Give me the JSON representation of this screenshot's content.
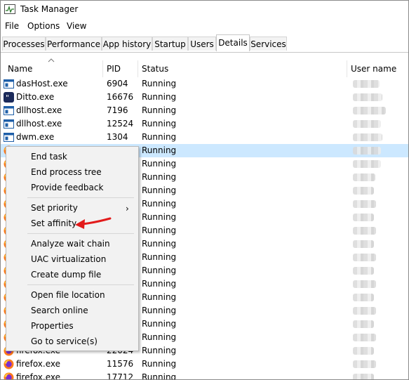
{
  "window": {
    "title": "Task Manager"
  },
  "menu": [
    "File",
    "Options",
    "View"
  ],
  "tabs": [
    "Processes",
    "Performance",
    "App history",
    "Startup",
    "Users",
    "Details",
    "Services"
  ],
  "active_tab": "Details",
  "columns": {
    "name": "Name",
    "pid": "PID",
    "status": "Status",
    "user": "User name"
  },
  "rows": [
    {
      "name": "dasHost.exe",
      "pid": "6904",
      "status": "Running",
      "icon": "generic-app-icon"
    },
    {
      "name": "Ditto.exe",
      "pid": "16676",
      "status": "Running",
      "icon": "ditto-icon"
    },
    {
      "name": "dllhost.exe",
      "pid": "7196",
      "status": "Running",
      "icon": "generic-app-icon"
    },
    {
      "name": "dllhost.exe",
      "pid": "12524",
      "status": "Running",
      "icon": "generic-app-icon"
    },
    {
      "name": "dwm.exe",
      "pid": "1304",
      "status": "Running",
      "icon": "generic-app-icon"
    },
    {
      "name": "",
      "pid": "",
      "status": "Running",
      "icon": "firefox-icon",
      "selected": true
    },
    {
      "name": "",
      "pid": "",
      "status": "Running",
      "icon": "firefox-icon"
    },
    {
      "name": "",
      "pid": "",
      "status": "Running",
      "icon": "firefox-icon"
    },
    {
      "name": "",
      "pid": "",
      "status": "Running",
      "icon": "firefox-icon"
    },
    {
      "name": "",
      "pid": "",
      "status": "Running",
      "icon": "firefox-icon"
    },
    {
      "name": "",
      "pid": "",
      "status": "Running",
      "icon": "firefox-icon"
    },
    {
      "name": "",
      "pid": "",
      "status": "Running",
      "icon": "firefox-icon"
    },
    {
      "name": "",
      "pid": "",
      "status": "Running",
      "icon": "firefox-icon"
    },
    {
      "name": "",
      "pid": "",
      "status": "Running",
      "icon": "firefox-icon"
    },
    {
      "name": "",
      "pid": "",
      "status": "Running",
      "icon": "firefox-icon"
    },
    {
      "name": "",
      "pid": "",
      "status": "Running",
      "icon": "firefox-icon"
    },
    {
      "name": "",
      "pid": "",
      "status": "Running",
      "icon": "firefox-icon"
    },
    {
      "name": "",
      "pid": "",
      "status": "Running",
      "icon": "firefox-icon"
    },
    {
      "name": "",
      "pid": "",
      "status": "Running",
      "icon": "firefox-icon"
    },
    {
      "name": "",
      "pid": "",
      "status": "Running",
      "icon": "firefox-icon"
    },
    {
      "name": "firefox.exe",
      "pid": "22024",
      "status": "Running",
      "icon": "firefox-icon"
    },
    {
      "name": "firefox.exe",
      "pid": "11576",
      "status": "Running",
      "icon": "firefox-icon"
    },
    {
      "name": "firefox.exe",
      "pid": "17712",
      "status": "Running",
      "icon": "firefox-icon"
    }
  ],
  "context_menu": {
    "groups": [
      [
        "End task",
        "End process tree",
        "Provide feedback"
      ],
      [
        "Set priority",
        "Set affinity"
      ],
      [
        "Analyze wait chain",
        "UAC virtualization",
        "Create dump file"
      ],
      [
        "Open file location",
        "Search online",
        "Properties",
        "Go to service(s)"
      ]
    ],
    "submenu_indicator": "›",
    "highlight_arrow_target": "Set affinity"
  },
  "colors": {
    "selection": "#cce8ff",
    "arrow": "#e21b1b",
    "menu_bg": "#f2f2f2"
  }
}
